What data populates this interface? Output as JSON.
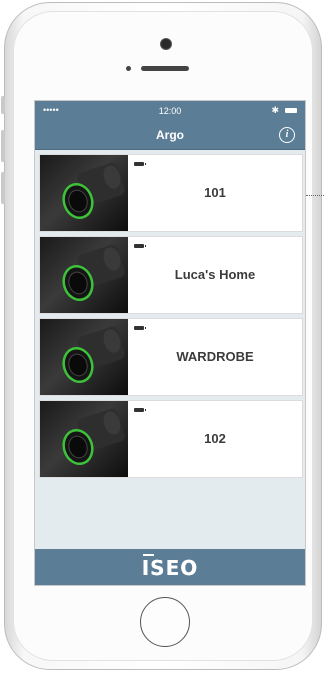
{
  "status_bar": {
    "signal": "•••••",
    "time": "12:00",
    "bluetooth": "✱"
  },
  "nav": {
    "title": "Argo",
    "info_icon": "i"
  },
  "locks": [
    {
      "label": "101",
      "icon": "battery-icon"
    },
    {
      "label": "Luca's Home",
      "icon": "battery-icon"
    },
    {
      "label": "WARDROBE",
      "icon": "battery-icon"
    },
    {
      "label": "102",
      "icon": "battery-icon"
    }
  ],
  "footer": {
    "logo": "ISEO"
  },
  "colors": {
    "header_blue": "#5b7d95",
    "list_bg": "#e4ebee",
    "lock_ring_green": "#3ec23a"
  }
}
